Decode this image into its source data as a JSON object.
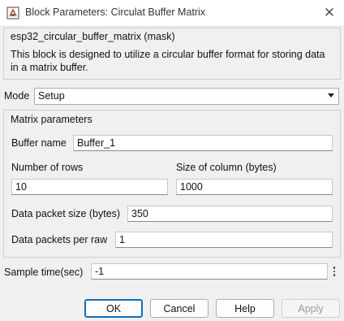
{
  "window": {
    "title": "Block Parameters: Circulat Buffer Matrix",
    "close_icon": "close-icon",
    "app_icon": "simulink-block-icon"
  },
  "mask": {
    "title": "esp32_circular_buffer_matrix (mask)",
    "description": "This block is designed to utilize a circular buffer format for storing data in a matrix buffer."
  },
  "mode": {
    "label": "Mode",
    "value": "Setup"
  },
  "matrix": {
    "group_title": "Matrix parameters",
    "buffer_name_label": "Buffer name",
    "buffer_name_value": "Buffer_1",
    "rows_label": "Number of rows",
    "rows_value": "10",
    "col_size_label": "Size of column (bytes)",
    "col_size_value": "1000",
    "packet_size_label": "Data packet size (bytes)",
    "packet_size_value": "350",
    "packets_per_raw_label": "Data packets per raw",
    "packets_per_raw_value": "1"
  },
  "sample": {
    "label": "Sample time(sec)",
    "value": "-1"
  },
  "buttons": {
    "ok": "OK",
    "cancel": "Cancel",
    "help": "Help",
    "apply": "Apply"
  },
  "colors": {
    "accent": "#0f6cbd",
    "background": "#f0f0f0"
  }
}
